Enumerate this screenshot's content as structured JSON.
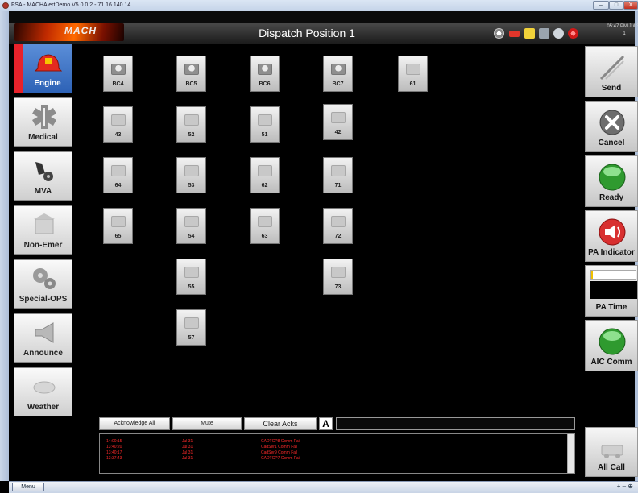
{
  "window": {
    "title": "FSA - MACHAlertDemo V5.0.0.2 - 71.16.140.14",
    "controls": {
      "minimize": "–",
      "maximize": "□",
      "close": "X"
    }
  },
  "header": {
    "logo_text": "MACH",
    "title": "Dispatch Position 1",
    "time": "05:47 PM Jul 31",
    "position_number": "1",
    "status_icons": [
      "satellite-dish-icon",
      "toolbox-icon",
      "note-icon",
      "document-icon",
      "sync-icon",
      "alarm-icon"
    ]
  },
  "left_nav": [
    {
      "label": "Engine",
      "icon": "firefighter-helmet-icon",
      "active": true
    },
    {
      "label": "Medical",
      "icon": "star-of-life-icon",
      "active": false
    },
    {
      "label": "MVA",
      "icon": "car-crash-icon",
      "active": false
    },
    {
      "label": "Non-Emer",
      "icon": "building-icon",
      "active": false
    },
    {
      "label": "Special-OPS",
      "icon": "gears-icon",
      "active": false
    },
    {
      "label": "Announce",
      "icon": "megaphone-icon",
      "active": false
    },
    {
      "label": "Weather",
      "icon": "weather-icon",
      "active": false
    }
  ],
  "units": {
    "columns": [
      [
        "BC4",
        "43",
        "64",
        "65"
      ],
      [
        "BC5",
        "52",
        "53",
        "54",
        "55",
        "57"
      ],
      [
        "BC6",
        "51",
        "62",
        "63"
      ],
      [
        "BC7",
        "42",
        "71",
        "72",
        "73"
      ],
      [
        "61"
      ]
    ]
  },
  "right_controls": [
    {
      "label": "Send",
      "icon": "send-slash-icon"
    },
    {
      "label": "Cancel",
      "icon": "cancel-x-icon"
    },
    {
      "label": "Ready",
      "icon": "green-light-icon"
    },
    {
      "label": "PA Indicator",
      "icon": "speaker-icon"
    },
    {
      "label": "PA Time",
      "icon": "pa-time-display"
    },
    {
      "label": "AIC Comm",
      "icon": "green-light-icon"
    }
  ],
  "all_call": {
    "label": "All Call",
    "icon": "truck-icon"
  },
  "ack_bar": {
    "acknowledge_all": "Acknowledge All",
    "mute": "Mute",
    "clear_acks": "Clear Acks",
    "font_icon": "A"
  },
  "event_log": [
    {
      "time": "14:00:15",
      "date": "Jul 31",
      "message": "CADTCP8 Comm Fail"
    },
    {
      "time": "13:40:20",
      "date": "Jul 31",
      "message": "CadSer1 Comm Fail"
    },
    {
      "time": "13:40:17",
      "date": "Jul 31",
      "message": "CadSer9 Comm Fail"
    },
    {
      "time": "13:37:43",
      "date": "Jul 31",
      "message": "CADTCP7 Comm Fail"
    }
  ],
  "status_bar": {
    "menu_label": "Menu",
    "zoom": "+ – ⊕"
  },
  "colors": {
    "active_red": "#e8222b",
    "active_blue": "#3a6fc4",
    "log_red": "#ff2a2a",
    "ready_green": "#3fbf3f"
  }
}
